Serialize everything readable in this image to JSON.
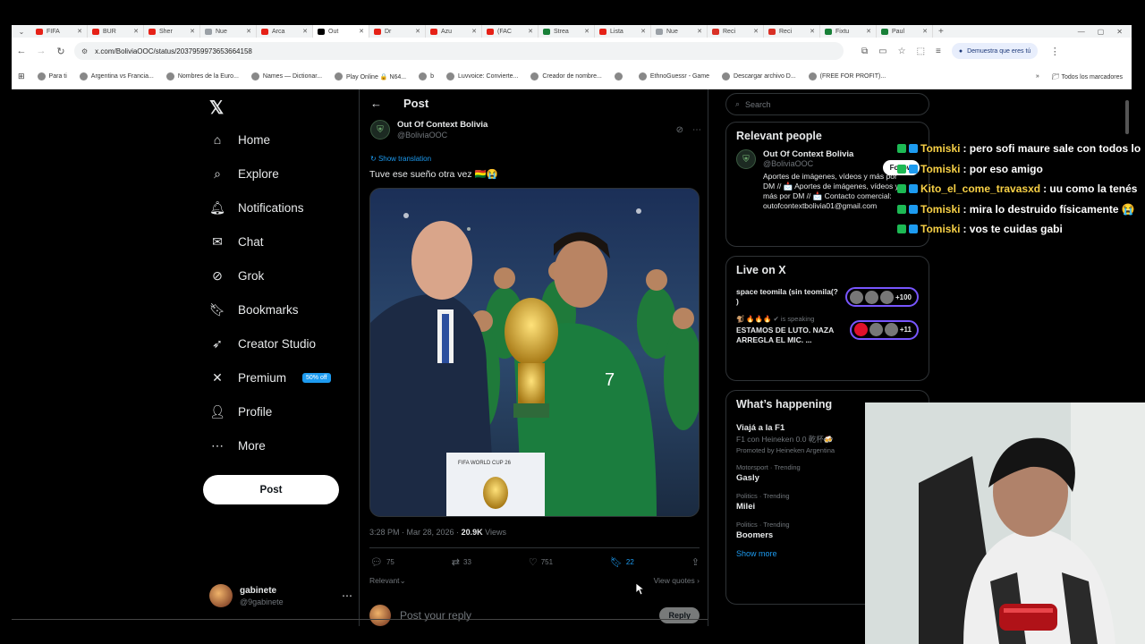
{
  "browser": {
    "tabs": [
      {
        "label": "FIFA",
        "color": "#e62117"
      },
      {
        "label": "BUR",
        "color": "#e62117"
      },
      {
        "label": "Sher",
        "color": "#e62117"
      },
      {
        "label": "Nue",
        "color": "#9aa0a6"
      },
      {
        "label": "Arca",
        "color": "#e62117"
      },
      {
        "label": "Out",
        "color": "#000000",
        "active": true
      },
      {
        "label": "Dr",
        "color": "#e62117"
      },
      {
        "label": "Azu",
        "color": "#e62117"
      },
      {
        "label": "(FAC",
        "color": "#e62117"
      },
      {
        "label": "Strea",
        "color": "#188038"
      },
      {
        "label": "Lista",
        "color": "#e62117"
      },
      {
        "label": "Nue",
        "color": "#9aa0a6"
      },
      {
        "label": "Reci",
        "color": "#d93025"
      },
      {
        "label": "Reci",
        "color": "#d93025"
      },
      {
        "label": "Fixtu",
        "color": "#188038"
      },
      {
        "label": "Paul",
        "color": "#188038"
      }
    ],
    "url": "x.com/BoliviaOOC/status/2037959973653664158",
    "verify_label": "Demuestra que eres tú",
    "bookmarks": [
      "Para ti",
      "Argentina vs Francia...",
      "Nombres de la Euro...",
      "Names — Dictionar...",
      "Play Online 🔒 N64...",
      "b",
      "Luvvoice: Convierte...",
      "Creador de nombre...",
      "",
      "EthnoGuessr - Game",
      "Descargar archivo D...",
      "(FREE FOR PROFIT)..."
    ],
    "bookmarks_all": "Todos los marcadores"
  },
  "sidebar": {
    "items": [
      {
        "label": "Home",
        "icon": "home-icon",
        "glyph": "⌂"
      },
      {
        "label": "Explore",
        "icon": "search-icon",
        "glyph": "⌕"
      },
      {
        "label": "Notifications",
        "icon": "bell-icon",
        "glyph": "🔔︎"
      },
      {
        "label": "Chat",
        "icon": "mail-icon",
        "glyph": "✉"
      },
      {
        "label": "Grok",
        "icon": "grok-icon",
        "glyph": "⊘"
      },
      {
        "label": "Bookmarks",
        "icon": "bookmark-icon",
        "glyph": "🔖︎"
      },
      {
        "label": "Creator Studio",
        "icon": "rocket-icon",
        "glyph": "➶"
      },
      {
        "label": "Premium",
        "icon": "x-icon",
        "glyph": "✕"
      },
      {
        "label": "Profile",
        "icon": "person-icon",
        "glyph": "👤︎"
      },
      {
        "label": "More",
        "icon": "more-icon",
        "glyph": "⋯"
      }
    ],
    "premium_badge": "50% off",
    "post_button": "Post",
    "account": {
      "name": "gabinete",
      "handle": "@9gabinete"
    }
  },
  "post": {
    "header": "Post",
    "author_name": "Out Of Context Bolivia",
    "author_handle": "@BoliviaOOC",
    "translate": "Show translation",
    "text": "Tuve ese sueño otra vez 🇧🇴😭",
    "image_caption": "FIFA WORLD CUP 26",
    "jersey_number": "7",
    "time": "3:28 PM · Mar 28, 2026 ·",
    "views_count": "20.9K",
    "views_label": "Views",
    "replies": "75",
    "reposts": "33",
    "likes": "751",
    "bookmarks": "22",
    "sort": "Relevant",
    "view_quotes": "View quotes",
    "reply_placeholder": "Post your reply",
    "reply_button": "Reply"
  },
  "right": {
    "search_placeholder": "Search",
    "relevant_title": "Relevant people",
    "person": {
      "name": "Out Of Context Bolivia",
      "handle": "@BoliviaOOC",
      "bio": "Aportes de imágenes, vídeos y más por DM // 📩 Aportes de imágenes, vídeos y más por DM // 📩 Contacto comercial: outofcontextbolivia01@gmail.com",
      "follow": "Follow"
    },
    "live_title": "Live on X",
    "live": [
      {
        "title": "space teomila (sin teomila(? )",
        "speaking": "",
        "count": "+100",
        "red": false
      },
      {
        "title": "ESTAMOS DE LUTO. NAZA ARREGLA EL MIC. ...",
        "speaking": "🐒 🔥🔥🔥 ✔ is speaking",
        "count": "+11",
        "red": true
      }
    ],
    "happening_title": "What’s happening",
    "trends": [
      {
        "ctx": "",
        "title": "Viajá a la F1",
        "sub": "F1 con Heineken 0.0 乾杯🍻",
        "promo": "Promoted by Heineken Argentina"
      },
      {
        "ctx": "Motorsport · Trending",
        "title": "Gasly",
        "sub": "",
        "promo": ""
      },
      {
        "ctx": "Politics · Trending",
        "title": "Milei",
        "sub": "",
        "promo": ""
      },
      {
        "ctx": "Politics · Trending",
        "title": "Boomers",
        "sub": "",
        "promo": ""
      }
    ],
    "show_more": "Show more"
  },
  "chat": [
    {
      "user": "Tomiski",
      "msg": ": pero sofi maure sale con todos lo"
    },
    {
      "user": "Tomiski",
      "msg": ": por eso amigo"
    },
    {
      "user": "Kito_el_come_travasxd",
      "msg": ": uu como la tenés"
    },
    {
      "user": "Tomiski",
      "msg": ": mira lo destruido físicamente 😭"
    },
    {
      "user": "Tomiski",
      "msg": ": vos te cuidas gabi"
    }
  ],
  "colors": {
    "accent": "#1d9bf0",
    "bg": "#000000",
    "chat_user": "#f7d046",
    "live_border": "#7856ff"
  }
}
